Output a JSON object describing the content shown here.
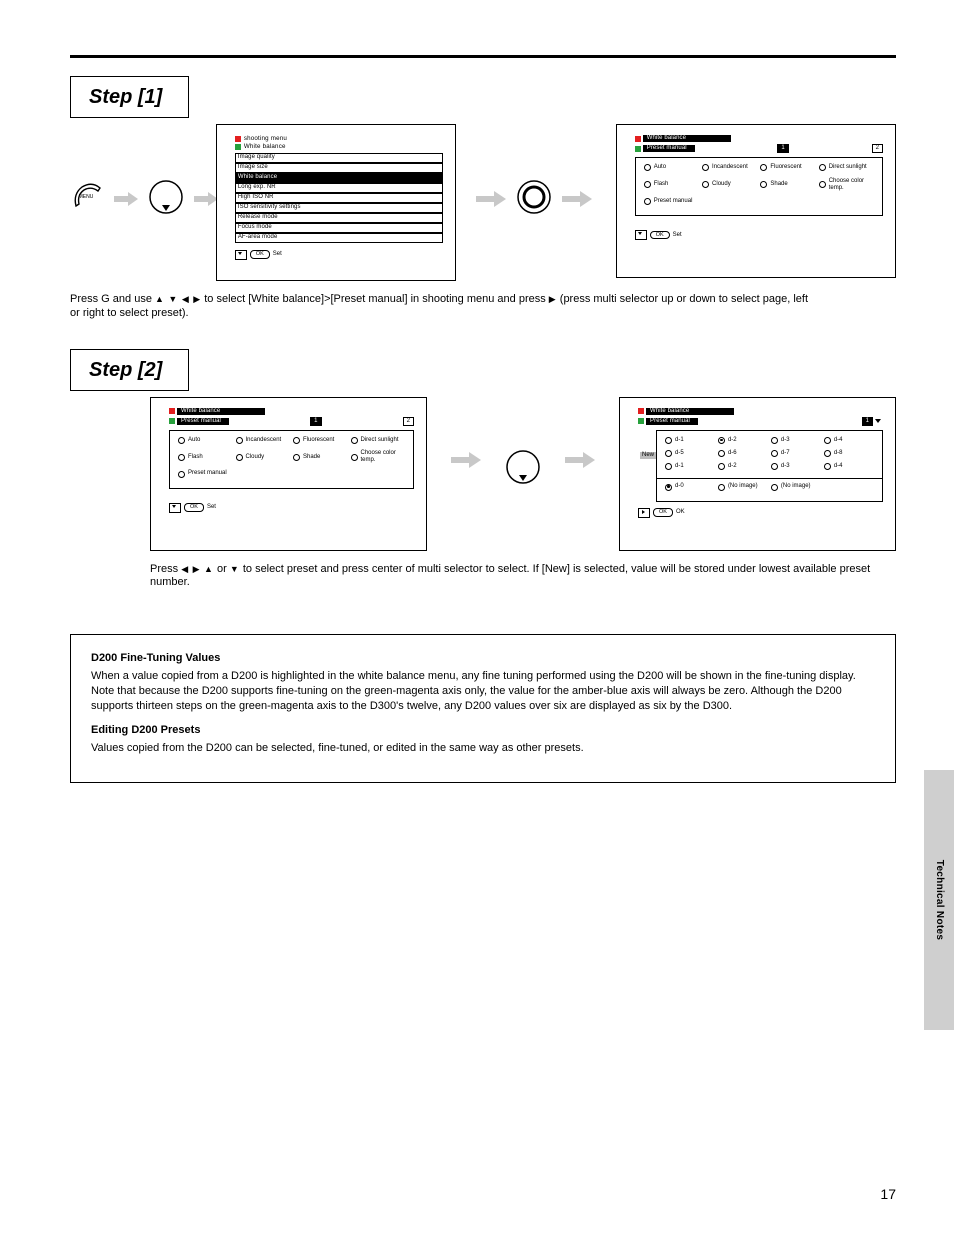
{
  "step1": {
    "label": "Step [1]",
    "menu": {
      "cat1": "shooting menu",
      "cat2": "White balance",
      "items": [
        "Image quality",
        "Image size",
        "White balance",
        "Long exp. NR",
        "High ISO NR",
        "ISO sensitivity settings",
        "Release mode",
        "Focus mode",
        "AF-area mode"
      ],
      "selectedIndex": 2,
      "chip": "Set"
    },
    "panel": {
      "cat1": "White balance",
      "cat2": "Preset manual",
      "page1": "1",
      "page2": "2",
      "options": [
        "Auto",
        "Incandescent",
        "Fluorescent",
        "Direct sunlight",
        "Flash",
        "Cloudy",
        "Shade",
        "Choose color temp.",
        "Preset manual"
      ],
      "selected": [],
      "chip": "Set"
    },
    "caption_a": "Press G and use ",
    "caption_b": " to select [White balance]>[Preset manual] in shooting menu and press ",
    "caption_c": " (press multi selector up or down to select page, left or right to select preset)."
  },
  "step2": {
    "label": "Step [2]",
    "panelL": {
      "cat1": "White balance",
      "cat2": "Preset manual",
      "page1": "1",
      "page2": "2",
      "options": [
        "Auto",
        "Incandescent",
        "Fluorescent",
        "Direct sunlight",
        "Flash",
        "Cloudy",
        "Shade",
        "Choose color temp.",
        "Preset manual"
      ],
      "chip": "Set"
    },
    "panelR": {
      "cat1": "White balance",
      "cat2": "Preset manual",
      "pageSel": "1",
      "newLabel": "New",
      "r1": [
        "d-1",
        "d-2",
        "d-3",
        "d-4"
      ],
      "r2": [
        "d-5",
        "d-6",
        "d-7",
        "d-8"
      ],
      "r3": [
        "d-1",
        "d-2",
        "d-3",
        "d-4"
      ],
      "r4": [
        "d-0",
        "(No image)",
        "(No image)",
        ""
      ],
      "chip": "OK"
    },
    "caption_a": "Press ",
    "caption_b": " or ",
    "caption_c": " to select preset and press center of multi selector to select.  If [New] is selected, value will be stored under lowest available preset number."
  },
  "box": {
    "h1": "D200 Fine-Tuning Values",
    "p1": "When a value copied from a D200 is highlighted in the white balance menu, any fine tuning performed using the D200 will be shown in the fine-tuning display.  Note that because the D200 supports fine-tuning on the green-magenta axis only, the value for the amber-blue axis will always be zero.  Although the D200 supports thirteen steps on the green-magenta axis to the D300's twelve, any D200 values over six are displayed as six by the D300.",
    "h2": "Editing D200 Presets",
    "p2": "Values copied from the D200 can be selected, fine-tuned, or edited in the same way as other presets."
  },
  "pageNumber": "17",
  "sideTab": "Technical Notes"
}
